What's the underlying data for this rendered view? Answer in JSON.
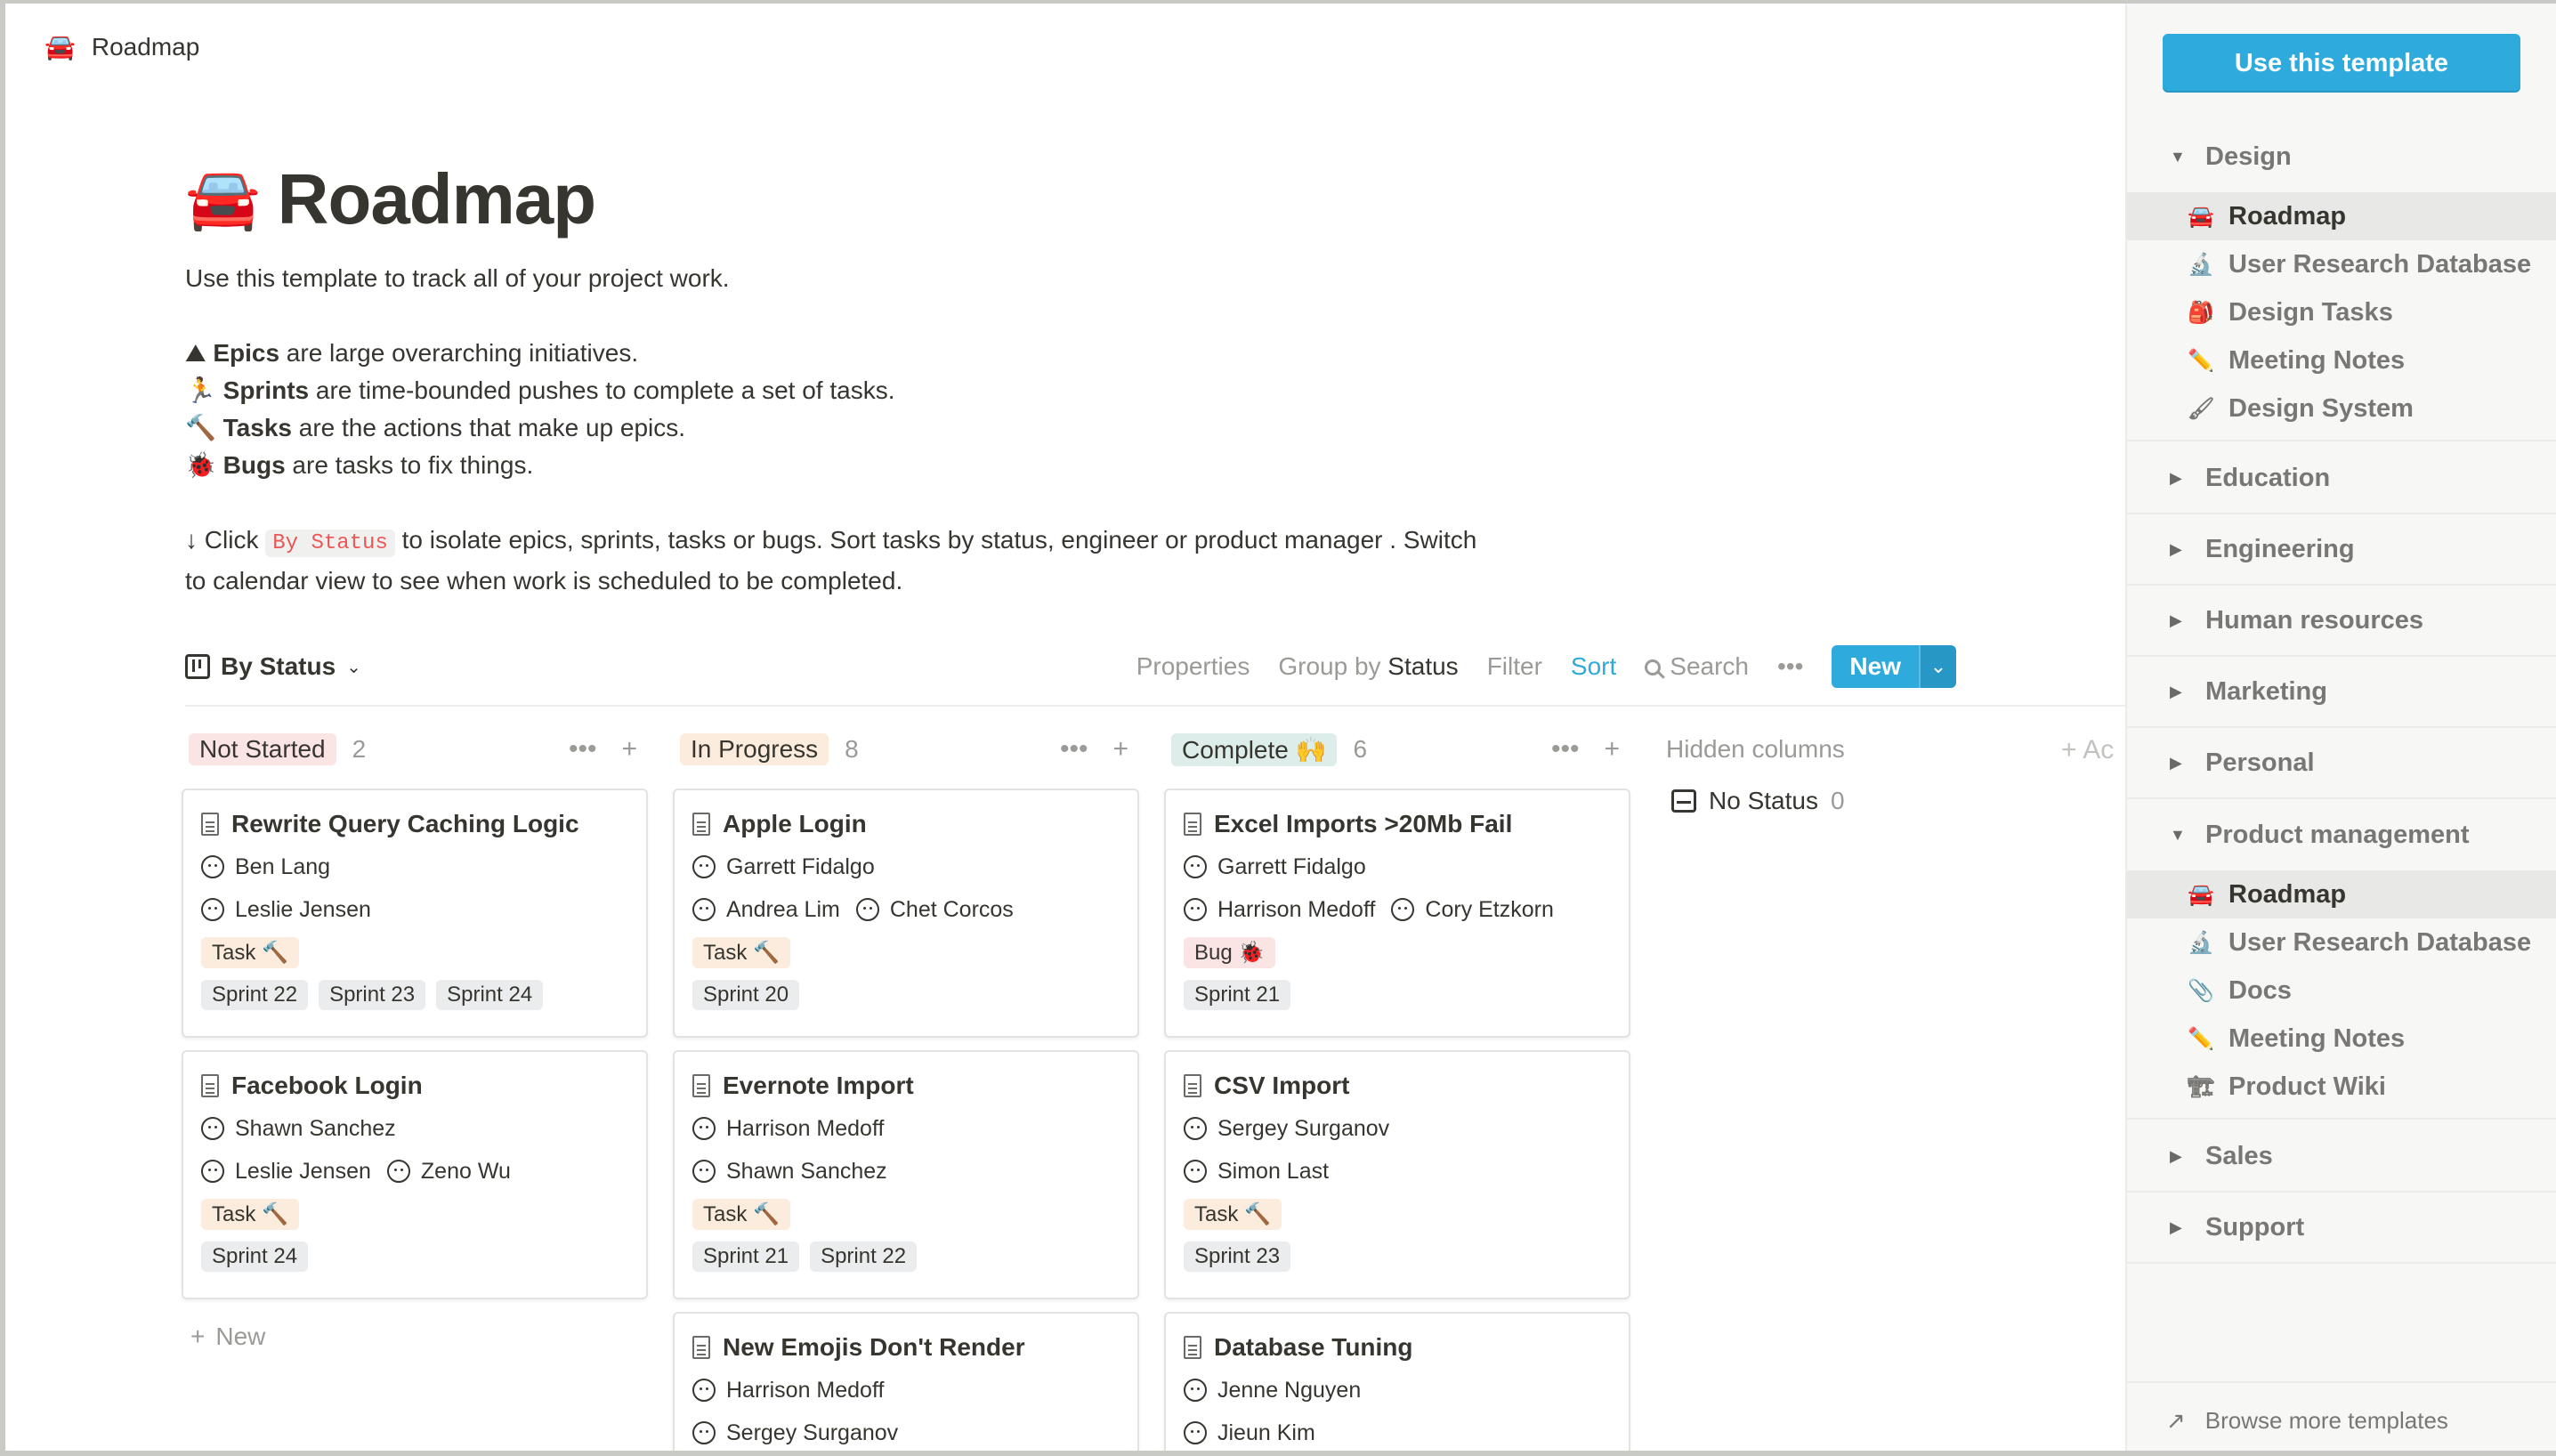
{
  "topbar": {
    "icon": "car-emoji",
    "icon_glyph": "🚘",
    "title": "Roadmap"
  },
  "page": {
    "title": "Roadmap",
    "title_glyph": "🚘",
    "intro": "Use this template to track all of your project work.",
    "definitions": [
      {
        "glyph": "⛰",
        "term": "Epics",
        "text": " are large overarching initiatives."
      },
      {
        "glyph": "🏃",
        "term": "Sprints",
        "text": " are time-bounded pushes to complete a set of tasks."
      },
      {
        "glyph": "🔨",
        "term": "Tasks",
        "text": " are the actions that make up epics."
      },
      {
        "glyph": "🐞",
        "term": "Bugs",
        "text": " are tasks to fix things."
      }
    ],
    "instruction_prefix": "↓ Click ",
    "instruction_code": "By Status",
    "instruction_line1": " to isolate epics, sprints, tasks or bugs. Sort tasks by status, engineer or product manager . Switch",
    "instruction_line2": "to calendar view to see when work is scheduled to be completed."
  },
  "toolbar": {
    "view_label": "By Status",
    "properties": "Properties",
    "group_by_prefix": "Group by",
    "group_by_value": "Status",
    "filter": "Filter",
    "sort": "Sort",
    "search": "Search",
    "more": "•••",
    "new": "New",
    "new_dropdown": "⌄"
  },
  "colors": {
    "accent": "#2eaadc",
    "not_started_bg": "#fbe4e4",
    "in_progress_bg": "#fbecdd",
    "complete_bg": "#ddedea",
    "task_bg": "#fbecdd",
    "bug_bg": "#fbe4e4",
    "sprint_bg": "#ebeced"
  },
  "board": {
    "columns": [
      {
        "label": "Not Started",
        "count": "2"
      },
      {
        "label": "In Progress",
        "count": "8"
      },
      {
        "label": "Complete 🙌",
        "count": "6"
      }
    ],
    "cards": [
      [
        {
          "title": "Rewrite Query Caching Logic",
          "rows": [
            [
              "Ben Lang"
            ],
            [
              "Leslie Jensen"
            ]
          ],
          "type": "Task 🔨",
          "sprints": [
            "Sprint 22",
            "Sprint 23",
            "Sprint 24"
          ]
        },
        {
          "title": "Facebook Login",
          "rows": [
            [
              "Shawn Sanchez"
            ],
            [
              "Leslie Jensen",
              "Zeno Wu"
            ]
          ],
          "type": "Task 🔨",
          "sprints": [
            "Sprint 24"
          ]
        }
      ],
      [
        {
          "title": "Apple Login",
          "rows": [
            [
              "Garrett Fidalgo"
            ],
            [
              "Andrea Lim",
              "Chet Corcos"
            ]
          ],
          "type": "Task 🔨",
          "sprints": [
            "Sprint 20"
          ]
        },
        {
          "title": "Evernote Import",
          "rows": [
            [
              "Harrison Medoff"
            ],
            [
              "Shawn Sanchez"
            ]
          ],
          "type": "Task 🔨",
          "sprints": [
            "Sprint 21",
            "Sprint 22"
          ]
        },
        {
          "title": "New Emojis Don't Render",
          "rows": [
            [
              "Harrison Medoff"
            ],
            [
              "Sergey Surganov"
            ]
          ]
        }
      ],
      [
        {
          "title": "Excel Imports >20Mb Fail",
          "rows": [
            [
              "Garrett Fidalgo"
            ],
            [
              "Harrison Medoff",
              "Cory Etzkorn"
            ]
          ],
          "type": "Bug 🐞",
          "sprints": [
            "Sprint 21"
          ]
        },
        {
          "title": "CSV Import",
          "rows": [
            [
              "Sergey Surganov"
            ],
            [
              "Simon Last"
            ]
          ],
          "type": "Task 🔨",
          "sprints": [
            "Sprint 23"
          ]
        },
        {
          "title": "Database Tuning",
          "rows": [
            [
              "Jenne Nguyen"
            ],
            [
              "Jieun Kim"
            ]
          ]
        }
      ]
    ],
    "add_new": "New",
    "hidden_columns": "Hidden columns",
    "add_group": "+ Ac",
    "no_status": "No Status",
    "no_status_count": "0"
  },
  "sidebar": {
    "use_template": "Use this template",
    "categories": [
      {
        "label": "Design",
        "expanded": true,
        "items": [
          {
            "glyph": "🚘",
            "label": "Roadmap",
            "active": true
          },
          {
            "glyph": "🔬",
            "label": "User Research Database"
          },
          {
            "glyph": "🎒",
            "label": "Design Tasks"
          },
          {
            "glyph": "✏️",
            "label": "Meeting Notes"
          },
          {
            "glyph": "🖌",
            "label": "Design System"
          }
        ]
      },
      {
        "label": "Education"
      },
      {
        "label": "Engineering"
      },
      {
        "label": "Human resources"
      },
      {
        "label": "Marketing"
      },
      {
        "label": "Personal"
      },
      {
        "label": "Product management",
        "expanded": true,
        "items": [
          {
            "glyph": "🚘",
            "label": "Roadmap",
            "active": true
          },
          {
            "glyph": "🔬",
            "label": "User Research Database"
          },
          {
            "glyph": "📎",
            "label": "Docs"
          },
          {
            "glyph": "✏️",
            "label": "Meeting Notes"
          },
          {
            "glyph": "🏗",
            "label": "Product Wiki"
          }
        ]
      },
      {
        "label": "Sales"
      },
      {
        "label": "Support"
      }
    ],
    "browse": "Browse more templates",
    "browse_glyph": "↗"
  }
}
